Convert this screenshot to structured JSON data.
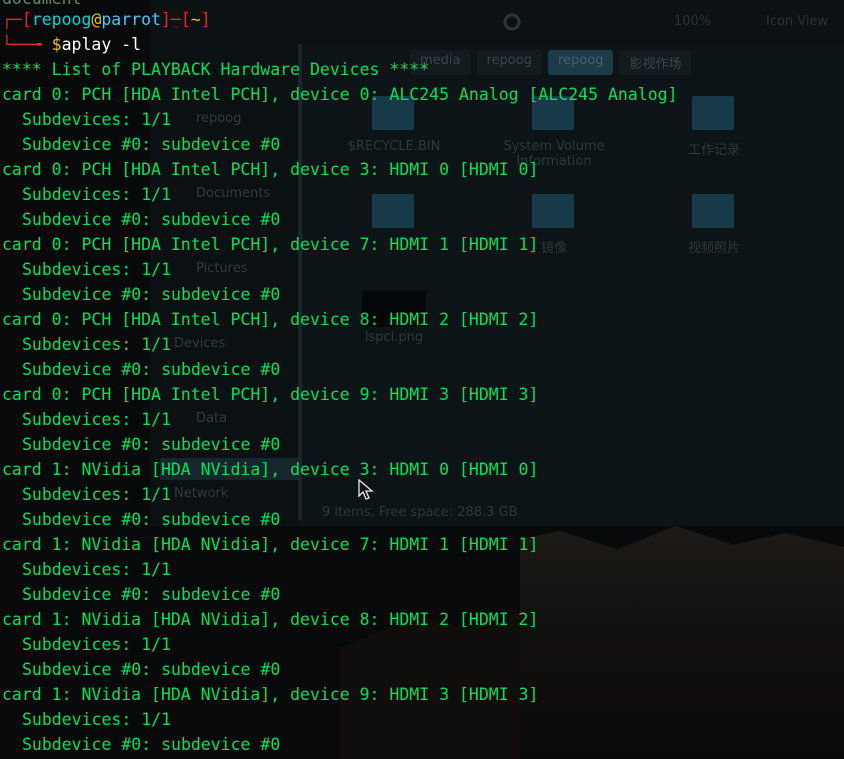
{
  "terminal": {
    "prev_output": "document",
    "prompt": {
      "user": "repoog",
      "at": "@",
      "host": "parrot",
      "dir": "~",
      "dollar": "$",
      "command": "aplay -l"
    },
    "header": "**** List of PLAYBACK Hardware Devices ****",
    "entries": [
      {
        "card": "card 0: PCH [HDA Intel PCH], device 0: ALC245 Analog [ALC245 Analog]",
        "subdevices": "Subdevices: 1/1",
        "subdevice": "Subdevice #0: subdevice #0"
      },
      {
        "card": "card 0: PCH [HDA Intel PCH], device 3: HDMI 0 [HDMI 0]",
        "subdevices": "Subdevices: 1/1",
        "subdevice": "Subdevice #0: subdevice #0"
      },
      {
        "card": "card 0: PCH [HDA Intel PCH], device 7: HDMI 1 [HDMI 1]",
        "subdevices": "Subdevices: 1/1",
        "subdevice": "Subdevice #0: subdevice #0"
      },
      {
        "card": "card 0: PCH [HDA Intel PCH], device 8: HDMI 2 [HDMI 2]",
        "subdevices": "Subdevices: 1/1",
        "subdevice": "Subdevice #0: subdevice #0"
      },
      {
        "card": "card 0: PCH [HDA Intel PCH], device 9: HDMI 3 [HDMI 3]",
        "subdevices": "Subdevices: 1/1",
        "subdevice": "Subdevice #0: subdevice #0"
      },
      {
        "card": "card 1: NVidia [HDA NVidia], device 3: HDMI 0 [HDMI 0]",
        "subdevices": "Subdevices: 1/1",
        "subdevice": "Subdevice #0: subdevice #0"
      },
      {
        "card": "card 1: NVidia [HDA NVidia], device 7: HDMI 1 [HDMI 1]",
        "subdevices": "Subdevices: 1/1",
        "subdevice": "Subdevice #0: subdevice #0"
      },
      {
        "card": "card 1: NVidia [HDA NVidia], device 8: HDMI 2 [HDMI 2]",
        "subdevices": "Subdevices: 1/1",
        "subdevice": "Subdevice #0: subdevice #0"
      },
      {
        "card": "card 1: NVidia [HDA NVidia], device 9: HDMI 3 [HDMI 3]",
        "subdevices": "Subdevices: 1/1",
        "subdevice": "Subdevice #0: subdevice #0"
      }
    ]
  },
  "background_file_manager": {
    "toolbar": {
      "zoom": "100%",
      "view": "Icon View"
    },
    "tabs": [
      "media",
      "repoog",
      "repoog",
      "影视作场"
    ],
    "sidebar": [
      "repoog",
      "Documents",
      "Pictures",
      "Devices",
      "Data",
      "Network"
    ],
    "items": [
      {
        "label": "$RECYCLE.BIN"
      },
      {
        "label": "System Volume Information"
      },
      {
        "label": "工作记录"
      },
      {
        "label": "镜像"
      },
      {
        "label": "视频照片"
      },
      {
        "label": "lspci.png"
      }
    ],
    "status": "9 items, Free space: 288.3 GB"
  },
  "colors": {
    "output_green": "#00e35a",
    "frame_red": "#e0282f",
    "user_cyan": "#00d7d7",
    "at_yellow": "#f0c000",
    "host_blue": "#47c8ff"
  },
  "icons": [
    "mouse-pointer-icon",
    "folder-icon",
    "refresh-icon"
  ]
}
